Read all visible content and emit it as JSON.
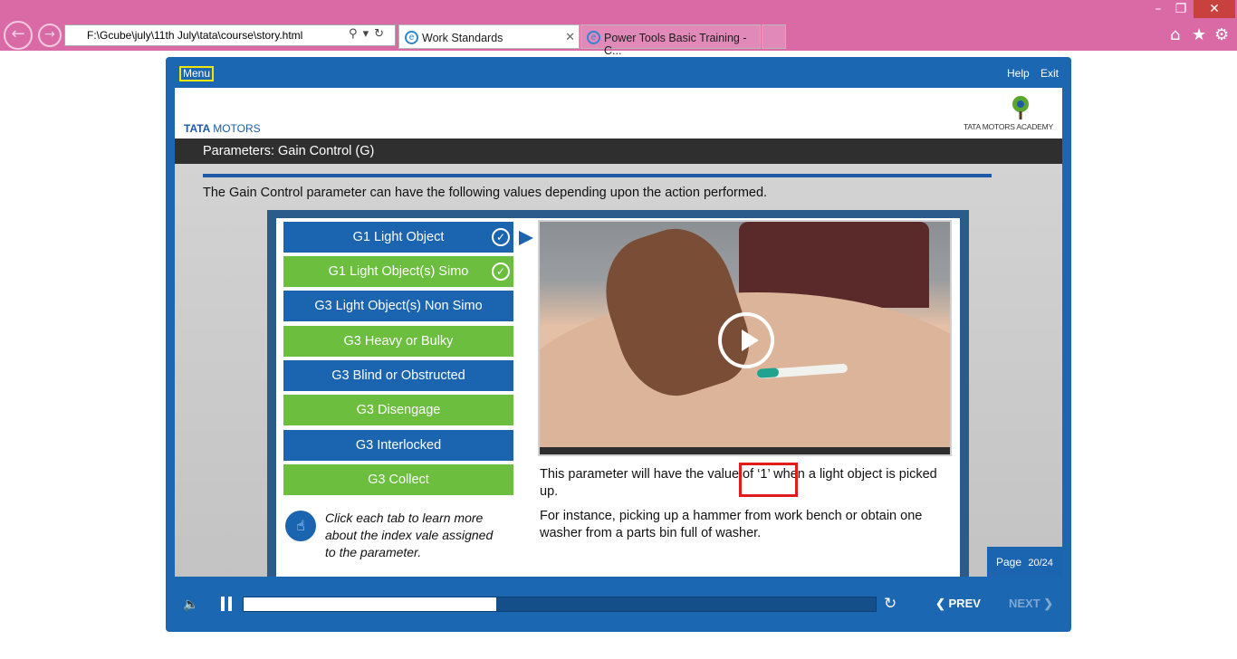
{
  "browser": {
    "address": "F:\\Gcube\\july\\11th July\\tata\\course\\story.html",
    "tabs": [
      {
        "label": "Work Standards",
        "active": true
      },
      {
        "label": "Power Tools Basic Training - C...",
        "active": false
      }
    ]
  },
  "player": {
    "menu_label": "Menu",
    "help_label": "Help",
    "exit_label": "Exit",
    "brand_left_bold": "TATA",
    "brand_left_rest": "MOTORS",
    "brand_right": "TATA MOTORS ACADEMY",
    "slide_title": "Parameters: Gain Control (G)",
    "intro": "The Gain Control parameter can have the following  values depending upon the action performed.",
    "tabs": [
      {
        "label": "G1 Light Object",
        "color": "blue",
        "checked": true
      },
      {
        "label": "G1 Light Object(s) Simo",
        "color": "green",
        "checked": true
      },
      {
        "label": "G3 Light Object(s) Non Simo",
        "color": "blue",
        "checked": false
      },
      {
        "label": "G3 Heavy or Bulky",
        "color": "green",
        "checked": false
      },
      {
        "label": "G3 Blind or Obstructed",
        "color": "blue",
        "checked": false
      },
      {
        "label": "G3 Disengage",
        "color": "green",
        "checked": false
      },
      {
        "label": "G3 Interlocked",
        "color": "blue",
        "checked": false
      },
      {
        "label": "G3 Collect",
        "color": "green",
        "checked": false
      }
    ],
    "hint": "Click each tab to learn more about the index vale assigned to the parameter.",
    "desc1": "This parameter will have the value of  ‘1’ when a light object is picked up.",
    "desc2": "For instance, picking up a hammer from work bench or obtain one washer from a parts bin full of washer.",
    "page_label": "Page",
    "page_num": "20/24",
    "prev_label": "PREV",
    "next_label": "NEXT",
    "progress": 0.4
  },
  "colors": {
    "accent_blue": "#1b64b0",
    "accent_green": "#6cbe3f",
    "chrome_pink": "#d96aa6",
    "highlight_red": "#e21c1c"
  }
}
